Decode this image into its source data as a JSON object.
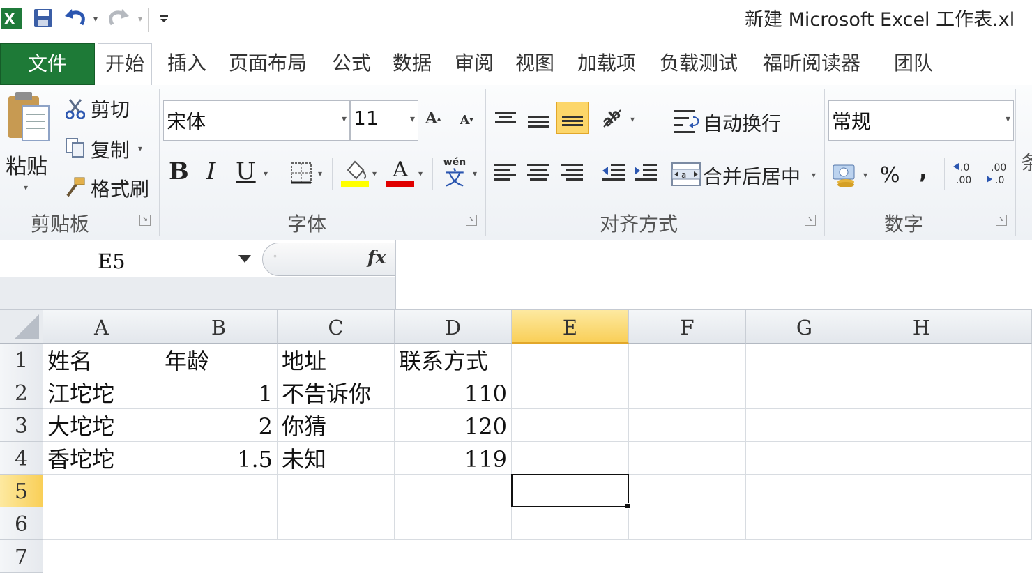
{
  "window": {
    "title": "新建 Microsoft Excel 工作表.xl",
    "app_icon": "excel-icon"
  },
  "tabs": [
    {
      "label": "文件"
    },
    {
      "label": "开始"
    },
    {
      "label": "插入"
    },
    {
      "label": "页面布局"
    },
    {
      "label": "公式"
    },
    {
      "label": "数据"
    },
    {
      "label": "审阅"
    },
    {
      "label": "视图"
    },
    {
      "label": "加载项"
    },
    {
      "label": "负载测试"
    },
    {
      "label": "福昕阅读器"
    },
    {
      "label": "团队"
    }
  ],
  "ribbon": {
    "clipboard": {
      "paste": "粘贴",
      "cut": "剪切",
      "copy": "复制",
      "format_painter": "格式刷",
      "group": "剪贴板"
    },
    "font": {
      "name": "宋体",
      "size": "11",
      "bold": "B",
      "italic": "I",
      "underline": "U",
      "font_color_glyph": "A",
      "phonetic_glyph": "wén",
      "group": "字体"
    },
    "alignment": {
      "wrap_text": "自动换行",
      "merge_center": "合并后居中",
      "group": "对齐方式"
    },
    "number": {
      "format": "常规",
      "percent": "%",
      "comma": ",",
      "group": "数字",
      "cut_off_label": "条"
    }
  },
  "formula_bar": {
    "name_box": "E5",
    "fx_label": "fx",
    "content": ""
  },
  "sheet": {
    "columns": [
      "A",
      "B",
      "C",
      "D",
      "E",
      "F",
      "G",
      "H"
    ],
    "selected_column": "E",
    "rows": [
      "1",
      "2",
      "3",
      "4",
      "5",
      "6",
      "7"
    ],
    "selected_row": "5",
    "cells": [
      [
        "姓名",
        "年龄",
        "地址",
        "联系方式",
        "",
        "",
        "",
        ""
      ],
      [
        "江坨坨",
        "1",
        "不告诉你",
        "110",
        "",
        "",
        "",
        ""
      ],
      [
        "大坨坨",
        "2",
        "你猜",
        "120",
        "",
        "",
        "",
        ""
      ],
      [
        "香坨坨",
        "1.5",
        "未知",
        "119",
        "",
        "",
        "",
        ""
      ],
      [
        "",
        "",
        "",
        "",
        "",
        "",
        "",
        ""
      ],
      [
        "",
        "",
        "",
        "",
        "",
        "",
        "",
        ""
      ]
    ]
  }
}
